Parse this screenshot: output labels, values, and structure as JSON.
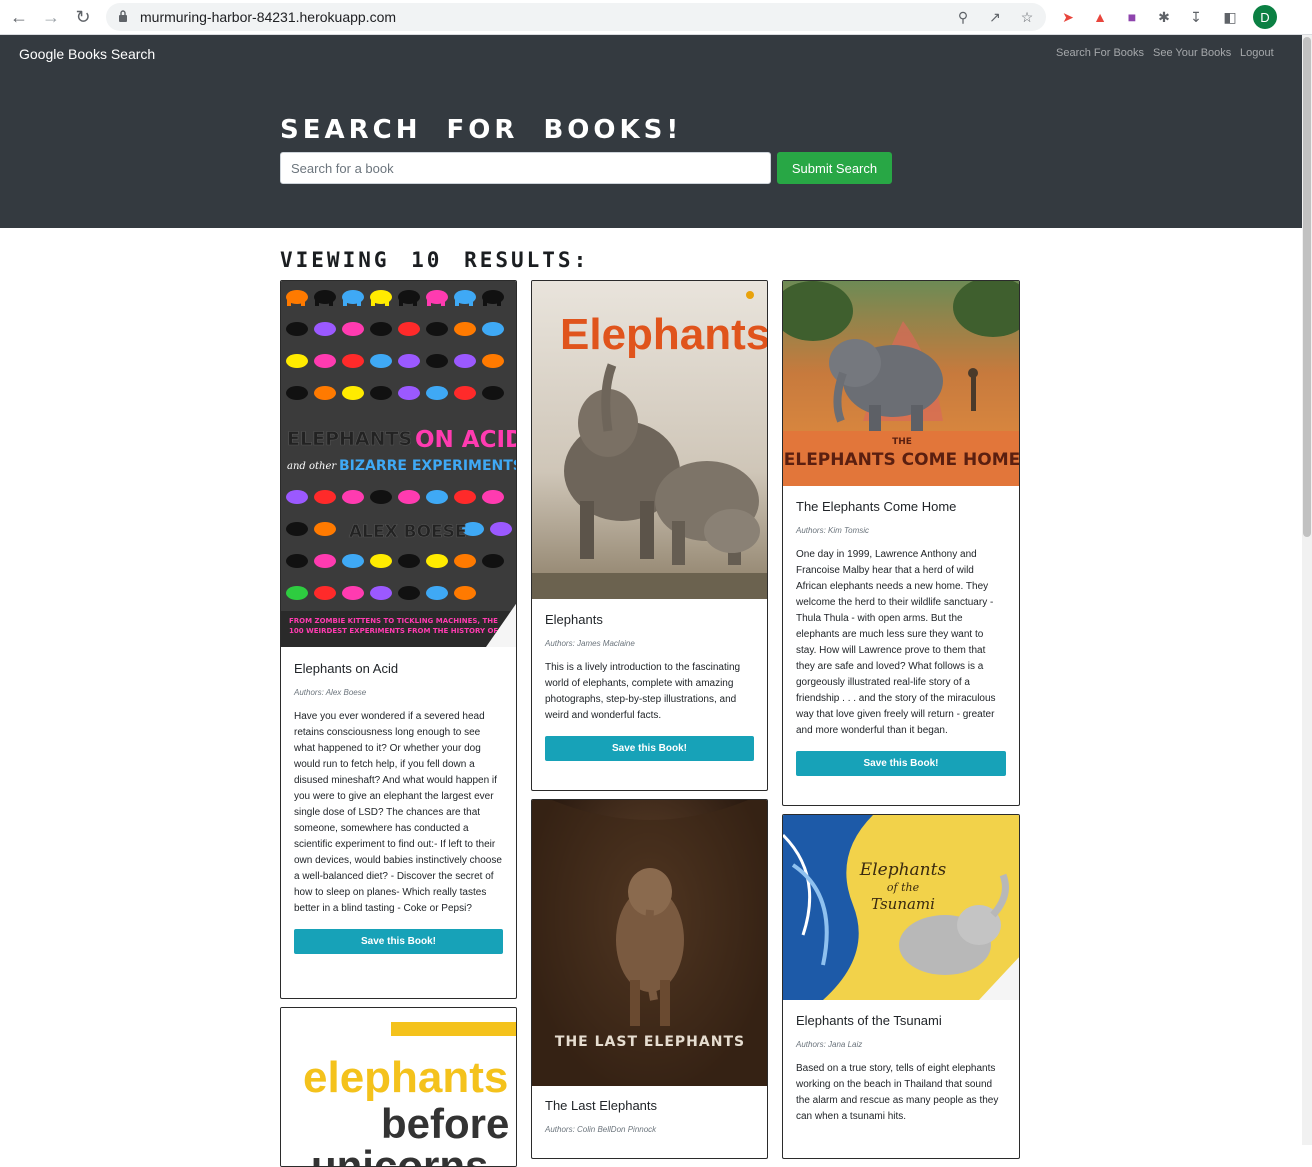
{
  "browser": {
    "url": "murmuring-harbor-84231.herokuapp.com",
    "profile_initial": "D"
  },
  "navbar": {
    "brand": "Google Books Search",
    "links": [
      "Search For Books",
      "See Your Books",
      "Logout"
    ]
  },
  "search": {
    "heading": "SEARCH FOR BOOKS!",
    "placeholder": "Search for a book",
    "submit_label": "Submit Search"
  },
  "results": {
    "heading": "VIEWING 10 RESULTS:",
    "books": [
      {
        "title": "Elephants on Acid",
        "authors": "Authors: Alex Boese",
        "description": "Have you ever wondered if a severed head retains consciousness long enough to see what happened to it? Or whether your dog would run to fetch help, if you fell down a disused mineshaft? And what would happen if you were to give an elephant the largest ever single dose of LSD? The chances are that someone, somewhere has conducted a scientific experiment to find out:- If left to their own devices, would babies instinctively choose a well-balanced diet? - Discover the secret of how to sleep on planes- Which really tastes better in a blind tasting - Coke or Pepsi?",
        "save_label": "Save this Book!",
        "cover_text": [
          "ELEPHANTS ON ACID",
          "and other BIZARRE EXPERIMENTS",
          "ALEX BOESE"
        ]
      },
      {
        "title": "Elephants",
        "authors": "Authors: James Maclaine",
        "description": "This is a lively introduction to the fascinating world of elephants, complete with amazing photographs, step-by-step illustrations, and weird and wonderful facts.",
        "save_label": "Save this Book!",
        "cover_text": [
          "Elephants"
        ]
      },
      {
        "title": "The Elephants Come Home",
        "authors": "Authors: Kim Tomsic",
        "description": "One day in 1999, Lawrence Anthony and Francoise Malby hear that a herd of wild African elephants needs a new home. They welcome the herd to their wildlife sanctuary - Thula Thula - with open arms. But the elephants are much less sure they want to stay. How will Lawrence prove to them that they are safe and loved? What follows is a gorgeously illustrated real-life story of a friendship . . . and the story of the miraculous way that love given freely will return - greater and more wonderful than it began.",
        "save_label": "Save this Book!",
        "cover_text": [
          "THE",
          "ELEPHANTS COME HOME"
        ]
      },
      {
        "title": "The Last Elephants",
        "authors": "Authors: Colin BellDon Pinnock",
        "cover_text": [
          "THE LAST ELEPHANTS"
        ]
      },
      {
        "title": "Elephants of the Tsunami",
        "authors": "Authors: Jana Laiz",
        "description": "Based on a true story, tells of eight elephants working on the beach in Thailand that sound the alarm and rescue as many people as they can when a tsunami hits.",
        "cover_text": [
          "Elephants",
          "of the",
          "Tsunami"
        ]
      },
      {
        "cover_text": [
          "elephants",
          "before",
          "unicorns"
        ]
      }
    ]
  },
  "colors": {
    "hero_bg": "#343a40",
    "submit": "#28a745",
    "save": "#17a2b8"
  }
}
